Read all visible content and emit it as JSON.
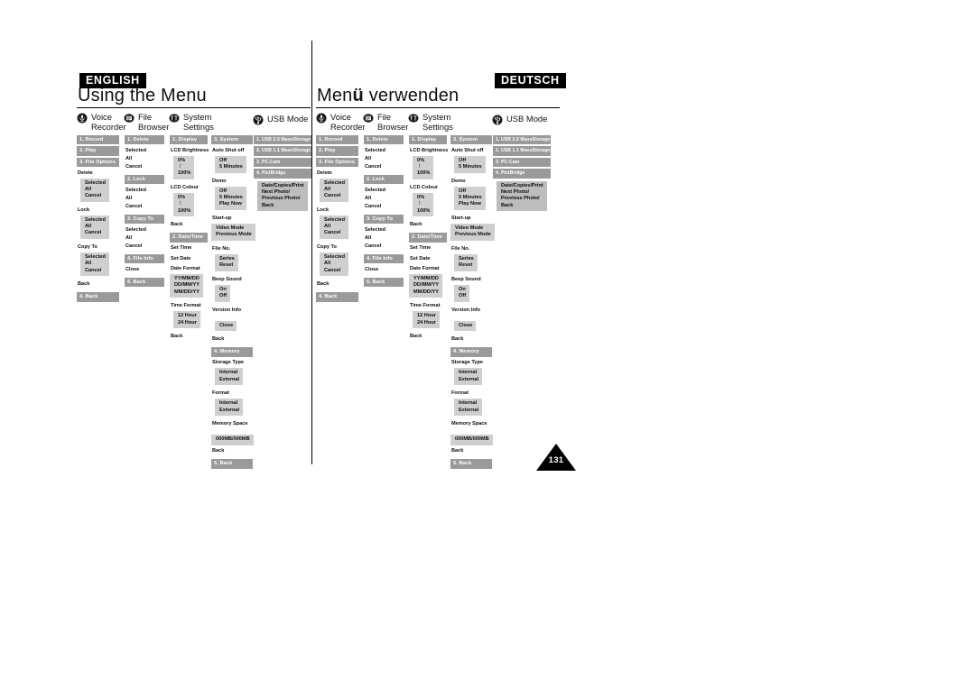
{
  "page": {
    "number": "131",
    "english_badge": "ENGLISH",
    "german_badge": "DEUTSCH",
    "english_title": "Using the Menu",
    "german_title_part1": "Men",
    "german_title_umlaut": "ü",
    "german_title_part2": " verwenden"
  },
  "categories": {
    "voice_recorder": {
      "line1": "Voice",
      "line2": "Recorder",
      "icon": "microphone-icon"
    },
    "file_browser": {
      "line1": "File",
      "line2": "Browser",
      "icon": "document-icon"
    },
    "system_settings": {
      "line1": "System",
      "line2": "Settings",
      "icon": "tools-icon"
    },
    "usb_mode": {
      "line1": "USB Mode",
      "line2": "",
      "icon": "usb-icon"
    }
  },
  "voice_recorder_menu": {
    "items": [
      "1. Record",
      "2. Play",
      "3. File Options"
    ],
    "delete_label": "Delete",
    "delete_options": [
      "Selected",
      "All",
      "Cancel"
    ],
    "lock_label": "Lock",
    "lock_options": [
      "Selected",
      "All",
      "Cancel"
    ],
    "copy_to_label": "Copy To",
    "copy_to_options": [
      "Selected",
      "All",
      "Cancel"
    ],
    "back_label": "Back",
    "back_band": "4. Back"
  },
  "file_browser_menu": {
    "delete_band": "1. Delete",
    "delete_options": [
      "Selected",
      "All",
      "Cancel"
    ],
    "lock_band": "2. Lock",
    "lock_options": [
      "Selected",
      "All",
      "Cancel"
    ],
    "copy_to_band": "3. Copy To",
    "copy_to_options": [
      "Selected",
      "All",
      "Cancel"
    ],
    "file_info_band": "4. File Info",
    "file_info_options": [
      "Close"
    ],
    "back_band": "5. Back"
  },
  "system_settings_display": {
    "display_band": "1. Display",
    "lcd_brightness_label": "LCD Brightness",
    "lcd_brightness_options": [
      "0%",
      "⋮",
      "100%"
    ],
    "lcd_colour_label": "LCD Colour",
    "lcd_colour_options": [
      "0%",
      "⋮",
      "100%"
    ],
    "back_label": "Back",
    "datetime_band": "2. Date/Time",
    "set_time_label": "Set Time",
    "set_date_label": "Set Date",
    "date_format_label": "Date Format",
    "date_format_options": [
      "YY/MM/DD",
      "DD/MM/YY",
      "MM/DD/YY"
    ],
    "time_format_label": "Time Format",
    "time_format_options": [
      "12 Hour",
      "24 Hour"
    ],
    "back2_label": "Back"
  },
  "system_settings_system": {
    "system_band": "3. System",
    "auto_shut_off_label": "Auto Shut off",
    "auto_shut_off_options": [
      "Off",
      "5 Minutes"
    ],
    "demo_label": "Demo",
    "demo_options": [
      "Off",
      "5 Minutes",
      "Play Now"
    ],
    "startup_label": "Start-up",
    "startup_options": [
      "Video Mode",
      "Previous Mode"
    ],
    "file_no_label": "File No.",
    "file_no_options": [
      "Series",
      "Reset"
    ],
    "beep_sound_label": "Beep Sound",
    "beep_sound_options": [
      "On",
      "Off"
    ],
    "version_info_label": "Version Info",
    "version_info_options": [
      "Close"
    ],
    "back_label": "Back",
    "memory_band": "4. Memory",
    "storage_type_label": "Storage Type",
    "storage_type_options": [
      "Internal",
      "External"
    ],
    "format_label": "Format",
    "format_options": [
      "Internal",
      "External"
    ],
    "memory_space_label": "Memory Space",
    "memory_space_value": "000MB/000MB",
    "memory_back_label": "Back",
    "back_band": "5. Back"
  },
  "usb_mode_menu": {
    "items": [
      "1. USB 2.0 MassStorage",
      "2. USB 1.1 MassStorage",
      "3. PC-Cam",
      "4. PictBridge"
    ],
    "pictbridge_options": [
      "Date/Copies/Print",
      "Next Photo/",
      "Previous Photo/",
      "Back"
    ]
  },
  "colors": {
    "band_gray": "#9a9a9a",
    "option_gray": "#cfcfcf",
    "badge_black": "#000000",
    "text_black": "#0b0b0b"
  }
}
